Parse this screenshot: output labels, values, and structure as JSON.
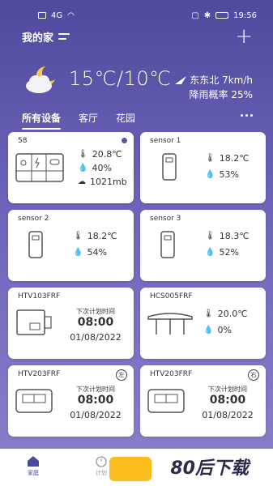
{
  "status_bar": {
    "time": "19:56",
    "signal": "4G",
    "battery": ""
  },
  "header": {
    "home_name": "我的家"
  },
  "weather": {
    "temperature": "15℃/10℃",
    "wind": "东东北 7km/h",
    "rain": "降雨概率 25%"
  },
  "tabs": [
    {
      "label": "所有设备",
      "active": true
    },
    {
      "label": "客厅",
      "active": false
    },
    {
      "label": "花园",
      "active": false
    }
  ],
  "cards": {
    "c1": {
      "title": "58",
      "temp": "20.8℃",
      "humidity": "40%",
      "pressure": "1021mb"
    },
    "c2": {
      "title": "sensor 1",
      "temp": "18.2℃",
      "humidity": "53%"
    },
    "c3": {
      "title": "sensor 2",
      "temp": "18.2℃",
      "humidity": "54%"
    },
    "c4": {
      "title": "sensor 3",
      "temp": "18.3℃",
      "humidity": "52%"
    },
    "c5": {
      "title": "HTV103FRF",
      "plan_label": "下次计划时间",
      "plan_time": "08:00",
      "plan_date": "01/08/2022"
    },
    "c6": {
      "title": "HCS005FRF",
      "temp": "20.0℃",
      "level": "0%"
    },
    "c7": {
      "title": "HTV203FRF",
      "badge": "左",
      "plan_label": "下次计划时间",
      "plan_time": "08:00",
      "plan_date": "01/08/2022"
    },
    "c8": {
      "title": "HTV203FRF",
      "badge": "右",
      "plan_label": "下次计划时间",
      "plan_time": "08:00",
      "plan_date": "01/08/2022"
    }
  },
  "bottom_nav": [
    {
      "label": "家庭",
      "active": true
    },
    {
      "label": "计划",
      "active": false
    }
  ],
  "watermark": "80后下载",
  "colors": {
    "accent": "#5a54a8",
    "background_top": "#4f4a9e",
    "card": "#ffffff"
  }
}
